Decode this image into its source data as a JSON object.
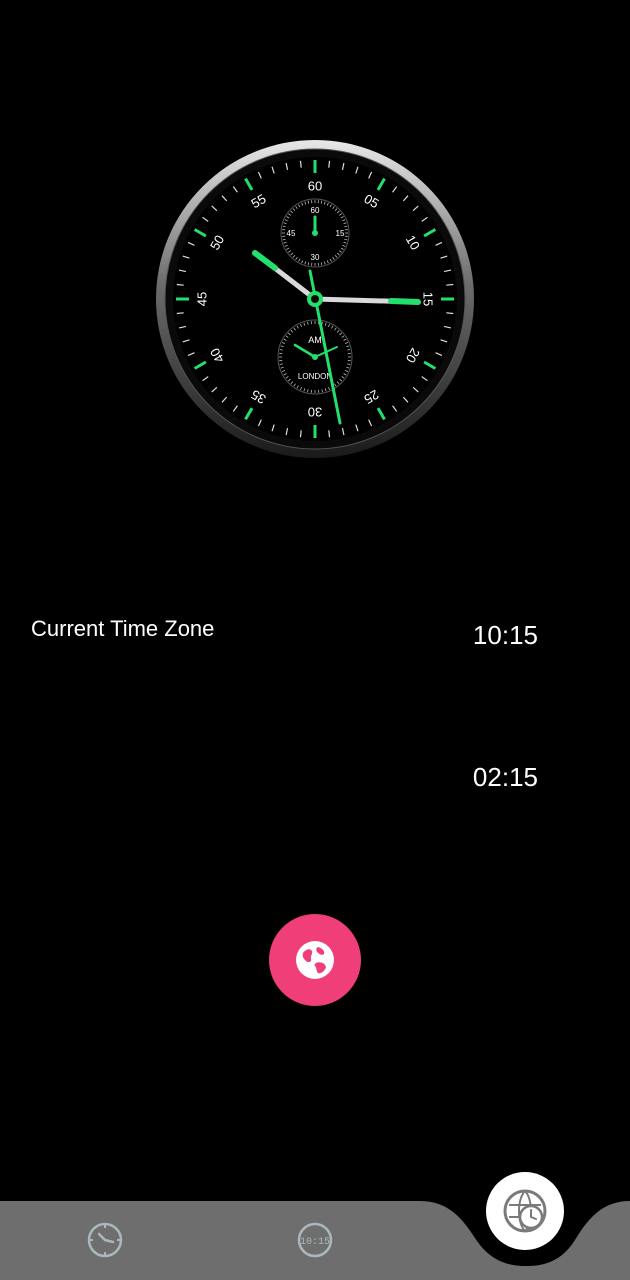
{
  "clock": {
    "big_numbers": [
      "60",
      "05",
      "10",
      "15",
      "20",
      "25",
      "30",
      "35",
      "40",
      "45",
      "50",
      "55"
    ],
    "sub_dial_top_numbers": [
      "60",
      "15",
      "30",
      "45"
    ],
    "sub_dial_bottom_ampm": "AM",
    "sub_dial_bottom_city": "LONDON",
    "accent_color": "#22e06b"
  },
  "timezones": [
    {
      "label": "Current Time Zone",
      "time": "10:15"
    },
    {
      "label": "",
      "time": "02:15"
    }
  ],
  "fab": {
    "icon": "globe-icon",
    "color": "#f03e78"
  },
  "bottom_nav": {
    "items": [
      {
        "icon": "analog-clock-icon"
      },
      {
        "icon": "digital-clock-icon",
        "text": "10:15"
      },
      {
        "icon": "world-clock-icon",
        "active": true
      }
    ],
    "bar_color": "#6e6e6e"
  }
}
